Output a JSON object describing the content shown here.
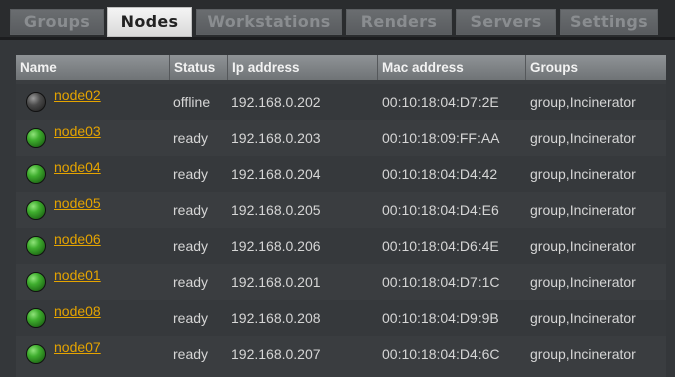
{
  "tabs": [
    {
      "label": "Groups",
      "active": false
    },
    {
      "label": "Nodes",
      "active": true
    },
    {
      "label": "Workstations",
      "active": false
    },
    {
      "label": "Renders",
      "active": false
    },
    {
      "label": "Servers",
      "active": false
    },
    {
      "label": "Settings",
      "active": false
    }
  ],
  "table": {
    "headers": [
      "Name",
      "Status",
      "Ip address",
      "Mac address",
      "Groups"
    ],
    "rows": [
      {
        "name": "node02",
        "status": "offline",
        "ip": "192.168.0.202",
        "mac": "00:10:18:04:D7:2E",
        "groups": "group,Incinerator",
        "icon": "offline-status-icon"
      },
      {
        "name": "node03",
        "status": "ready",
        "ip": "192.168.0.203",
        "mac": "00:10:18:09:FF:AA",
        "groups": "group,Incinerator",
        "icon": "ready-status-icon"
      },
      {
        "name": "node04",
        "status": "ready",
        "ip": "192.168.0.204",
        "mac": "00:10:18:04:D4:42",
        "groups": "group,Incinerator",
        "icon": "ready-status-icon"
      },
      {
        "name": "node05",
        "status": "ready",
        "ip": "192.168.0.205",
        "mac": "00:10:18:04:D4:E6",
        "groups": "group,Incinerator",
        "icon": "ready-status-icon"
      },
      {
        "name": "node06",
        "status": "ready",
        "ip": "192.168.0.206",
        "mac": "00:10:18:04:D6:4E",
        "groups": "group,Incinerator",
        "icon": "ready-status-icon"
      },
      {
        "name": "node01",
        "status": "ready",
        "ip": "192.168.0.201",
        "mac": "00:10:18:04:D7:1C",
        "groups": "group,Incinerator",
        "icon": "ready-status-icon"
      },
      {
        "name": "node08",
        "status": "ready",
        "ip": "192.168.0.208",
        "mac": "00:10:18:04:D9:9B",
        "groups": "group,Incinerator",
        "icon": "ready-status-icon"
      },
      {
        "name": "node07",
        "status": "ready",
        "ip": "192.168.0.207",
        "mac": "00:10:18:04:D4:6C",
        "groups": "group,Incinerator",
        "icon": "ready-status-icon"
      }
    ]
  },
  "colors": {
    "link": "#e5a400",
    "ready": "#3fae2e",
    "offline": "#4b4b4b"
  }
}
